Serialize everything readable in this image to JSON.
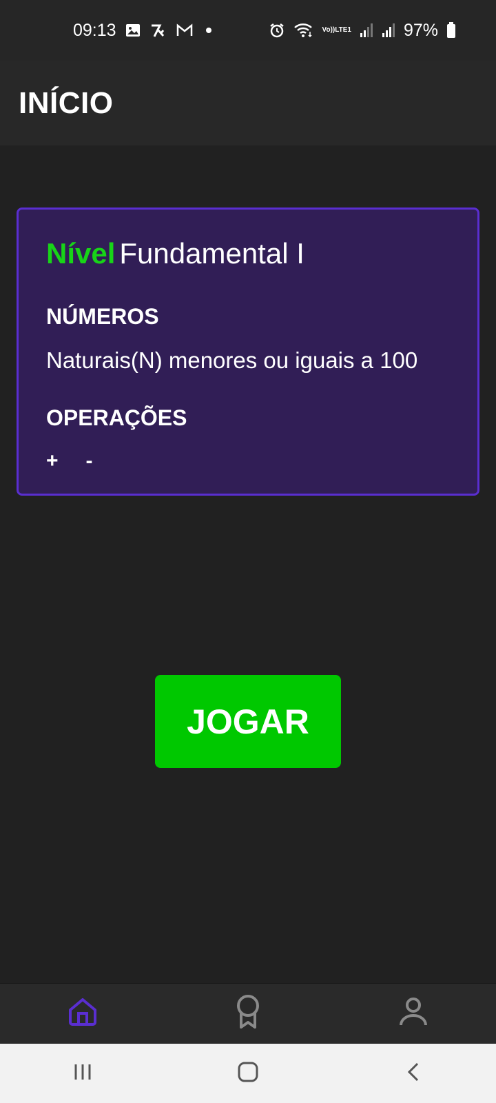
{
  "status_bar": {
    "time": "09:13",
    "lte_top": "Vo))",
    "lte_bottom": "LTE1",
    "battery": "97%",
    "icons": [
      "gallery-icon",
      "app-notification-icon",
      "gmail-icon",
      "more-dot-icon",
      "alarm-icon",
      "wifi-icon",
      "volte-icon",
      "signal-icon",
      "signal-icon",
      "battery-icon"
    ]
  },
  "app_bar": {
    "title": "INÍCIO"
  },
  "card": {
    "level_label": "Nível",
    "level_value": "Fundamental I",
    "numbers_heading": "NÚMEROS",
    "numbers_text": "Naturais(N) menores ou iguais a 100",
    "operations_heading": "OPERAÇÕES",
    "operations": [
      "+",
      "-"
    ]
  },
  "play_button": {
    "label": "JOGAR"
  },
  "bottom_nav": {
    "items": [
      "home-icon",
      "award-icon",
      "profile-icon"
    ],
    "active": "home-icon",
    "active_color": "#5a2ed0",
    "inactive_color": "#8a8a8a"
  },
  "colors": {
    "background": "#212121",
    "card_bg": "#311e56",
    "card_border": "#5a2ed0",
    "accent_green": "#18d418",
    "button_green": "#00c800"
  }
}
